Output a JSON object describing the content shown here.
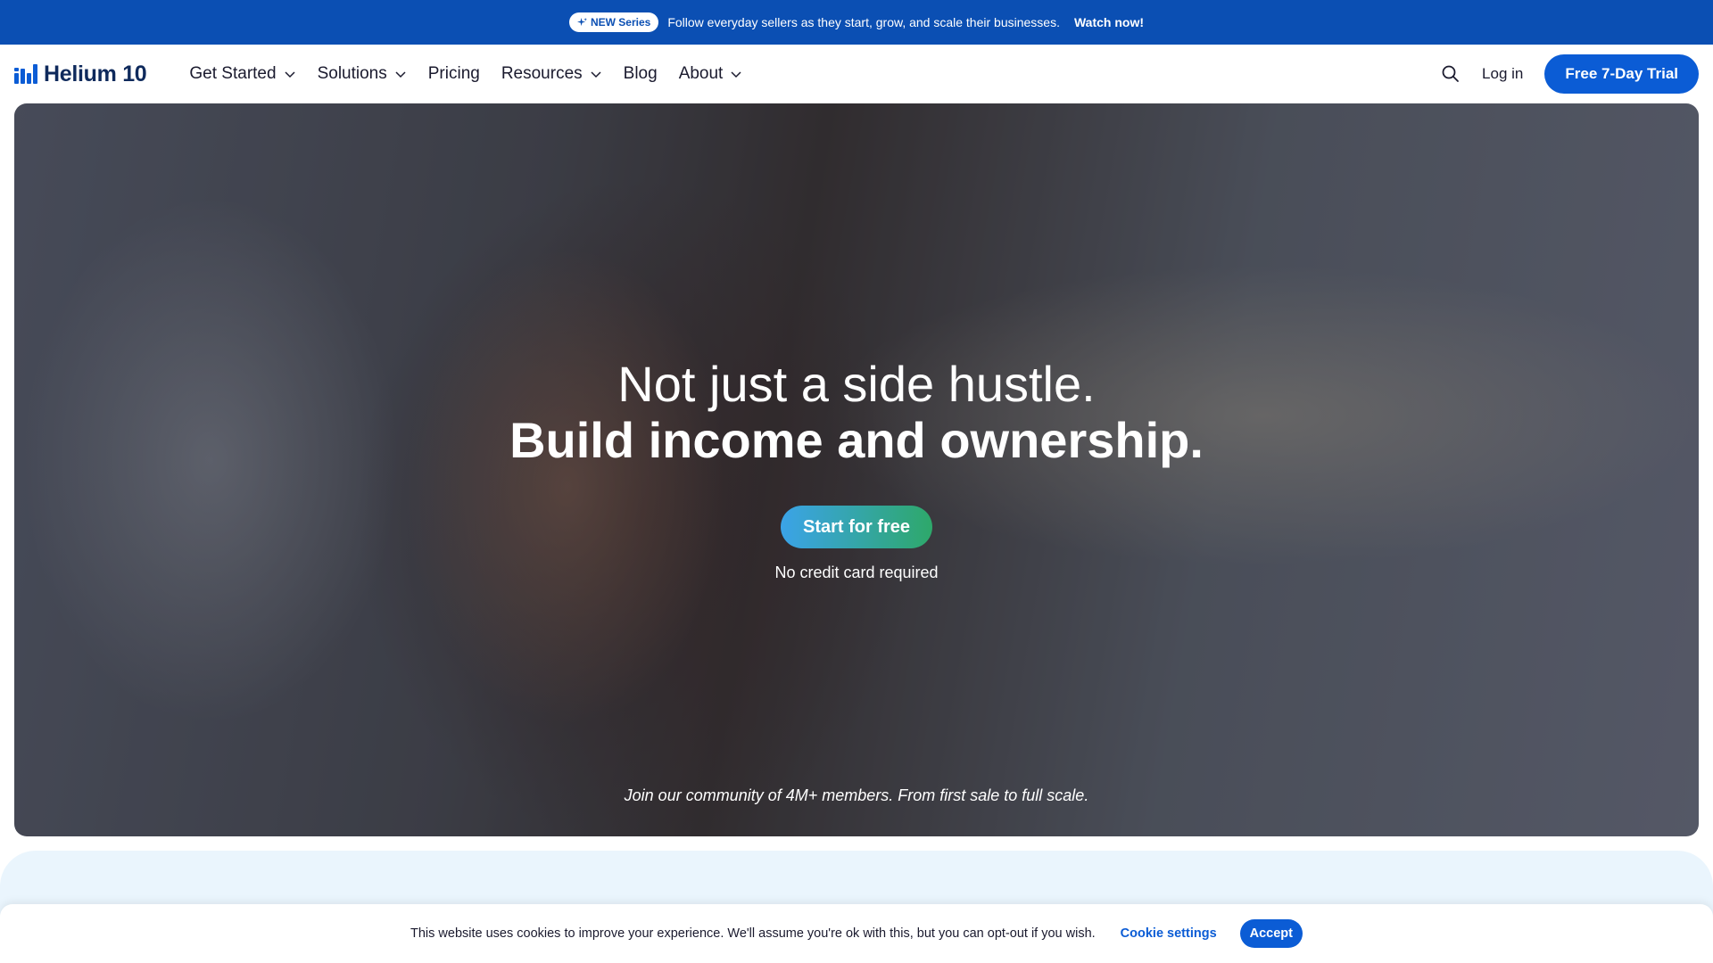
{
  "announcement": {
    "badge_label": "NEW Series",
    "text": "Follow everyday sellers as they start, grow, and scale their businesses.",
    "cta": "Watch now!"
  },
  "header": {
    "logo_text": "Helium 10",
    "nav": [
      {
        "label": "Get Started",
        "has_dropdown": true
      },
      {
        "label": "Solutions",
        "has_dropdown": true
      },
      {
        "label": "Pricing",
        "has_dropdown": false
      },
      {
        "label": "Resources",
        "has_dropdown": true
      },
      {
        "label": "Blog",
        "has_dropdown": false
      },
      {
        "label": "About",
        "has_dropdown": true
      }
    ],
    "login_label": "Log in",
    "trial_label": "Free 7-Day Trial",
    "search_icon": "search-icon"
  },
  "hero": {
    "headline_light": "Not just a side hustle.",
    "headline_bold": "Build income and ownership.",
    "cta_label": "Start for free",
    "subtext": "No credit card required",
    "community_text": "Join our community of 4M+ members. From first sale to full scale."
  },
  "cookie_banner": {
    "text": "This website uses cookies to improve your experience. We'll assume you're ok with this, but you can opt-out if you wish.",
    "settings_label": "Cookie settings",
    "accept_label": "Accept"
  },
  "colors": {
    "brand_blue": "#0b5cd5",
    "announce_bg": "#0b4fb3",
    "cta_gradient_start": "#3ba3e8",
    "cta_gradient_end": "#2ea86a",
    "section_bg": "#eaf5fd"
  }
}
